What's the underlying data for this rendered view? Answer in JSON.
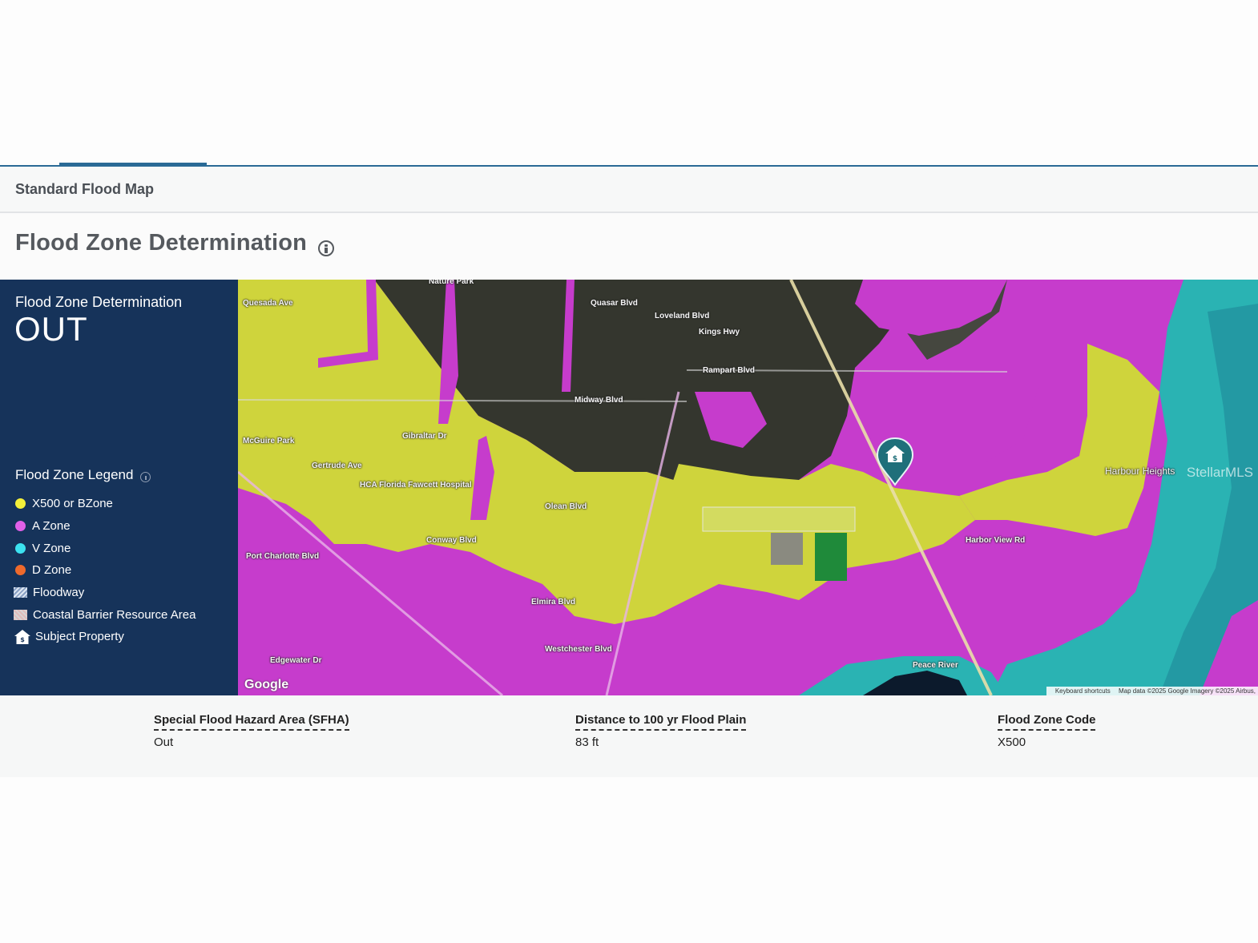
{
  "tabs": {
    "active_label": "Standard Flood Map"
  },
  "header": {
    "title": "Flood Zone Determination"
  },
  "panel": {
    "determination_label": "Flood Zone Determination",
    "determination_value": "OUT",
    "legend_title": "Flood Zone Legend",
    "legend": [
      {
        "label": "X500 or BZone",
        "color": "#f4f03a",
        "icon": "yellow-dot"
      },
      {
        "label": "A Zone",
        "color": "#e060e8",
        "icon": "magenta-dot"
      },
      {
        "label": "V Zone",
        "color": "#3ce2f0",
        "icon": "cyan-dot"
      },
      {
        "label": "D Zone",
        "color": "#ef6a2c",
        "icon": "orange-dot"
      },
      {
        "label": "Floodway",
        "icon": "hatch-swatch"
      },
      {
        "label": "Coastal Barrier Resource Area",
        "icon": "crosshatch-swatch"
      },
      {
        "label": "Subject Property",
        "icon": "house-icon"
      }
    ]
  },
  "map": {
    "labels": [
      "Nature Park",
      "Quesada Ave",
      "Quasar Blvd",
      "Midway Blvd",
      "Rampart Blvd",
      "McGuire Park",
      "Gertrude Ave",
      "HCA Florida Fawcett Hospital",
      "Olean Blvd",
      "Elmira Blvd",
      "Westchester Blvd",
      "Harbour Heights",
      "Peace River",
      "Harbor View Rd",
      "Loveland Blvd",
      "Kings Hwy",
      "Gibraltar Dr",
      "Conway Blvd",
      "Port Charlotte Blvd",
      "Edgewater Dr"
    ],
    "google_logo": "Google",
    "attribution_shortcuts": "Keyboard shortcuts",
    "attribution_data": "Map data ©2025 Google Imagery ©2025 Airbus,",
    "watermark": "StellarMLS"
  },
  "summary": {
    "sfha_label": "Special Flood Hazard Area (SFHA)",
    "sfha_value": "Out",
    "distance_label": "Distance to 100 yr Flood Plain",
    "distance_value": "83 ft",
    "code_label": "Flood Zone Code",
    "code_value": "X500"
  },
  "colors": {
    "accent": "#2a6a96",
    "panel_bg": "#16335a",
    "zone_x500": "#d9de3a",
    "zone_a": "#c63ccc",
    "zone_v": "#2ab3b3"
  }
}
